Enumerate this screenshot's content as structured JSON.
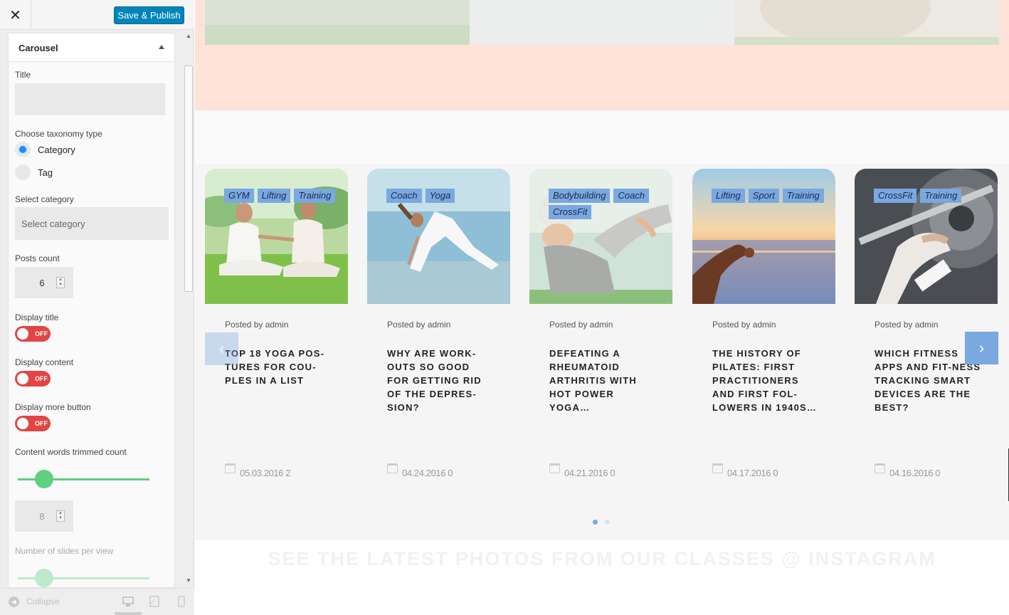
{
  "sidebar": {
    "close_label": "✕",
    "publish_label": "Save & Publish",
    "section_title": "Carousel",
    "title_label": "Title",
    "title_value": "",
    "taxonomy_label": "Choose taxonomy type",
    "taxonomy_options": [
      "Category",
      "Tag"
    ],
    "taxonomy_selected": "Category",
    "select_category_label": "Select category",
    "select_category_placeholder": "Select category",
    "posts_count_label": "Posts count",
    "posts_count_value": "6",
    "display_title_label": "Display title",
    "display_content_label": "Display content",
    "display_more_label": "Display more button",
    "toggle_off_text": "OFF",
    "trim_count_label": "Content words trimmed count",
    "trim_count_value": "8",
    "trim_slider_level": 0.2,
    "slides_per_view_label": "Number of slides per view",
    "slides_slider_level": 0.2,
    "collapse_label": "Collapse",
    "preview_devices": [
      "desktop-icon",
      "tablet-icon",
      "mobile-icon"
    ]
  },
  "carousel": {
    "posts": [
      {
        "tags": [
          "GYM",
          "Lifting",
          "Training"
        ],
        "posted_by": "Posted by admin",
        "title": "Top 18 yoga pos-tures for cou-ples in a list",
        "date": "05.03.2016",
        "comments": "2",
        "image": "yoga-couple"
      },
      {
        "tags": [
          "Coach",
          "Yoga"
        ],
        "posted_by": "Posted by admin",
        "title": "Why are work-outs so good for getting rid of the depres-sion?",
        "date": "04.24.2016",
        "comments": "0",
        "image": "beach-yoga"
      },
      {
        "tags": [
          "Bodybuilding",
          "Coach",
          "CrossFit"
        ],
        "posted_by": "Posted by admin",
        "title": "Defeating a rheumatoid arthritis with hot power yoga…",
        "date": "04.21.2016",
        "comments": "0",
        "image": "senior-stretch"
      },
      {
        "tags": [
          "Lifting",
          "Sport",
          "Training"
        ],
        "posted_by": "Posted by admin",
        "title": "The history of pilates: first practitioners and first fol-lowers in 1940s…",
        "date": "04.17.2016",
        "comments": "0",
        "image": "sunset-meditation"
      },
      {
        "tags": [
          "CrossFit",
          "Training"
        ],
        "posted_by": "Posted by admin",
        "title": "Which fitness apps and fit-ness tracking smart devices are the best?",
        "date": "04.16.2016",
        "comments": "0",
        "image": "barbell-grip"
      }
    ],
    "prev_label": "‹",
    "next_label": "›",
    "active_page": 1,
    "page_count": 2
  },
  "instagram_heading": "See the latest photos from our classes @ Instagram",
  "colors": {
    "accent": "#7aa8e0",
    "publish": "#0085ba",
    "toggle_off": "#e24545",
    "slider": "#5fcf80",
    "hero_band": "#ffe2d8"
  }
}
